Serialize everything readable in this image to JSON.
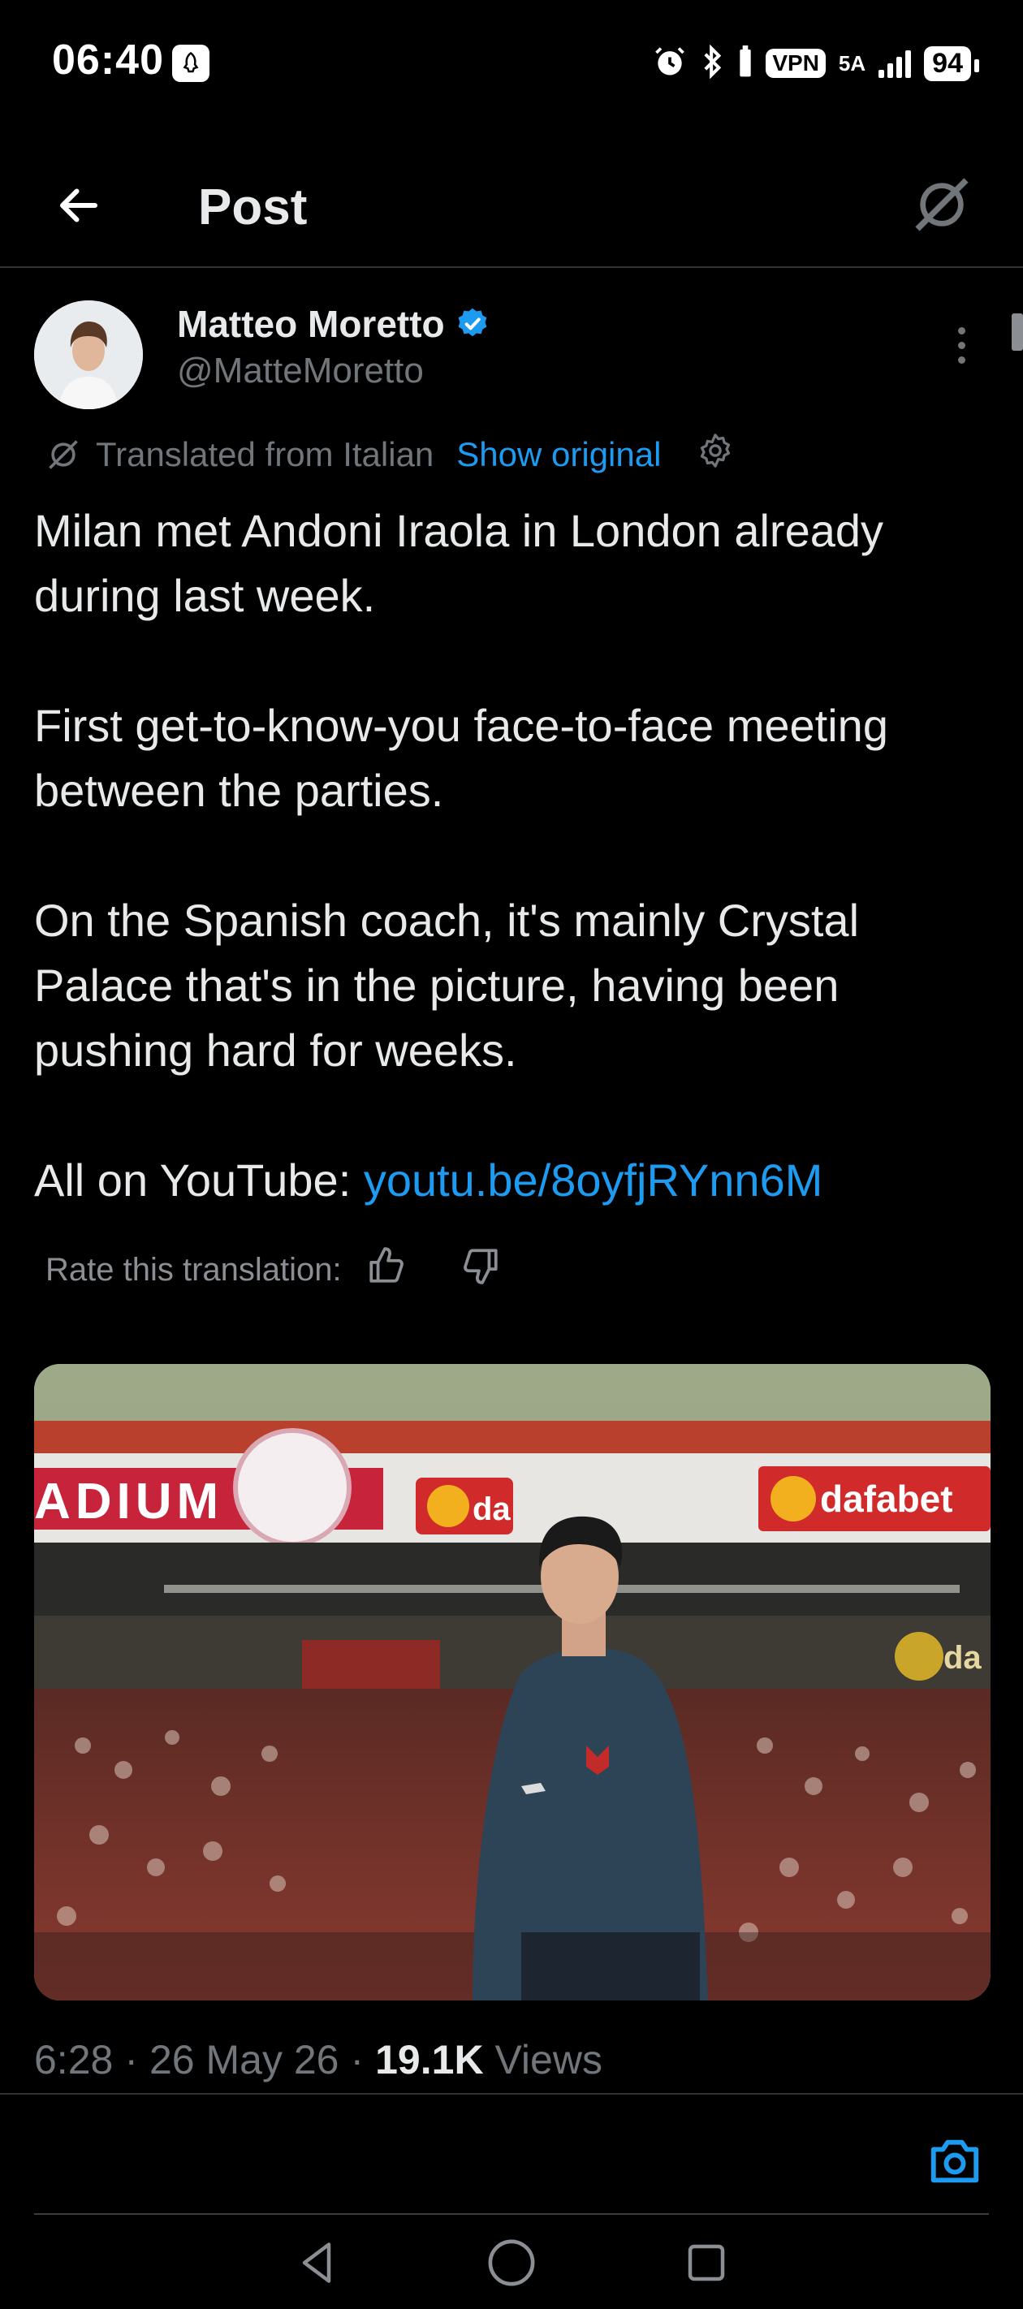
{
  "status_bar": {
    "time": "06:40",
    "vpn": "VPN",
    "network": "5A",
    "battery": "94"
  },
  "header": {
    "title": "Post"
  },
  "author": {
    "name": "Matteo Moretto",
    "handle": "@MatteMoretto"
  },
  "translation": {
    "label": "Translated from Italian",
    "show_original": "Show original",
    "rate_label": "Rate this translation:"
  },
  "tweet": {
    "paragraphs": [
      "Milan met Andoni Iraola in London already during last week.",
      "First get-to-know-you face-to-face meeting between the parties.",
      "On the Spanish coach, it's mainly Crystal Palace that's in the picture, having been pushing hard for weeks."
    ],
    "link_prefix": "All on YouTube: ",
    "link_text": "youtu.be/8oyfjRYnn6M"
  },
  "media": {
    "banner_left": "ADIUM",
    "banner_right": "dafabet",
    "banner_mid": "da",
    "banner_lower": "da"
  },
  "meta": {
    "time": "6:28",
    "separator": "·",
    "date": "26 May 26",
    "views_count": "19.1K",
    "views_label": "Views"
  },
  "colors": {
    "background": "#000000",
    "text": "#e7e9ea",
    "muted": "#71767b",
    "accent": "#1d9bf0"
  },
  "icons": {
    "back": "arrow-left-icon",
    "grok": "grok-icon",
    "verified": "verified-badge-icon",
    "more": "more-vertical-icon",
    "translate": "translate-icon",
    "settings": "gear-icon",
    "thumbs_up": "thumbs-up-icon",
    "thumbs_down": "thumbs-down-icon",
    "camera": "camera-icon",
    "nav_back": "triangle-back-icon",
    "nav_home": "circle-home-icon",
    "nav_recents": "square-recents-icon"
  }
}
